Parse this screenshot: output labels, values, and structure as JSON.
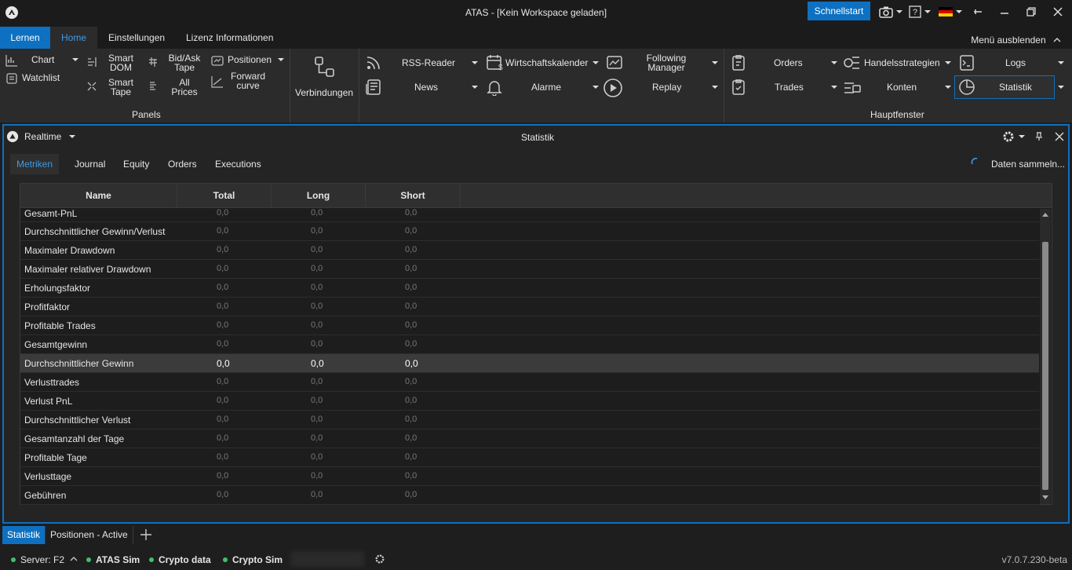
{
  "window": {
    "title": "ATAS - [Kein Workspace geladen]",
    "quickstart": "Schnellstart"
  },
  "menu": {
    "tabs": [
      "Lernen",
      "Home",
      "Einstellungen",
      "Lizenz Informationen"
    ],
    "hide": "Menü ausblenden"
  },
  "ribbon": {
    "panels": {
      "chart": "Chart",
      "watchlist": "Watchlist",
      "smart_dom": [
        "Smart",
        "DOM"
      ],
      "smart_tape": [
        "Smart",
        "Tape"
      ],
      "bidask_tape": [
        "Bid/Ask",
        "Tape"
      ],
      "all_prices": [
        "All",
        "Prices"
      ],
      "positionen": "Positionen",
      "forward_curve": [
        "Forward",
        "curve"
      ],
      "group": "Panels"
    },
    "verbindungen": "Verbindungen",
    "tools": {
      "rss": "RSS-Reader",
      "news": "News",
      "wirtschaftskalender": "Wirtschaftskalender",
      "alarme": "Alarme",
      "following_manager": [
        "Following",
        "Manager"
      ],
      "replay": "Replay"
    },
    "hauptfenster": {
      "orders": "Orders",
      "trades": "Trades",
      "handelsstrategien": "Handelsstrategien",
      "konten": "Konten",
      "logs": "Logs",
      "statistik": "Statistik",
      "group": "Hauptfenster"
    }
  },
  "panel": {
    "mode": "Realtime",
    "title": "Statistik",
    "tabs": [
      "Metriken",
      "Journal",
      "Equity",
      "Orders",
      "Executions"
    ],
    "status": "Daten sammeln...",
    "columns": [
      "Name",
      "Total",
      "Long",
      "Short"
    ],
    "rows": [
      {
        "name": "Gesamt-PnL",
        "total": "0,0",
        "long": "0,0",
        "short": "0,0"
      },
      {
        "name": "Durchschnittlicher Gewinn/Verlust",
        "total": "0,0",
        "long": "0,0",
        "short": "0,0"
      },
      {
        "name": "Maximaler Drawdown",
        "total": "0,0",
        "long": "0,0",
        "short": "0,0"
      },
      {
        "name": "Maximaler relativer Drawdown",
        "total": "0,0",
        "long": "0,0",
        "short": "0,0"
      },
      {
        "name": "Erholungsfaktor",
        "total": "0,0",
        "long": "0,0",
        "short": "0,0"
      },
      {
        "name": "Profitfaktor",
        "total": "0,0",
        "long": "0,0",
        "short": "0,0"
      },
      {
        "name": "Profitable Trades",
        "total": "0,0",
        "long": "0,0",
        "short": "0,0"
      },
      {
        "name": "Gesamtgewinn",
        "total": "0,0",
        "long": "0,0",
        "short": "0,0"
      },
      {
        "name": "Durchschnittlicher Gewinn",
        "total": "0,0",
        "long": "0,0",
        "short": "0,0"
      },
      {
        "name": "Verlusttrades",
        "total": "0,0",
        "long": "0,0",
        "short": "0,0"
      },
      {
        "name": "Verlust PnL",
        "total": "0,0",
        "long": "0,0",
        "short": "0,0"
      },
      {
        "name": "Durchschnittlicher Verlust",
        "total": "0,0",
        "long": "0,0",
        "short": "0,0"
      },
      {
        "name": "Gesamtanzahl der Tage",
        "total": "0,0",
        "long": "0,0",
        "short": "0,0"
      },
      {
        "name": "Profitable Tage",
        "total": "0,0",
        "long": "0,0",
        "short": "0,0"
      },
      {
        "name": "Verlusttage",
        "total": "0,0",
        "long": "0,0",
        "short": "0,0"
      },
      {
        "name": "Gebühren",
        "total": "0,0",
        "long": "0,0",
        "short": "0,0"
      }
    ],
    "selected_row": "Durchschnittlicher Gewinn"
  },
  "bottom_tabs": [
    "Statistik",
    "Positionen - Active"
  ],
  "statusbar": {
    "server": "Server: F2",
    "items": [
      "ATAS Sim",
      "Crypto data",
      "Crypto Sim"
    ],
    "version": "v7.0.7.230-beta"
  },
  "colors": {
    "accent": "#0e70c0",
    "link": "#3d9be9",
    "status_ok": "#3fbf6f"
  }
}
